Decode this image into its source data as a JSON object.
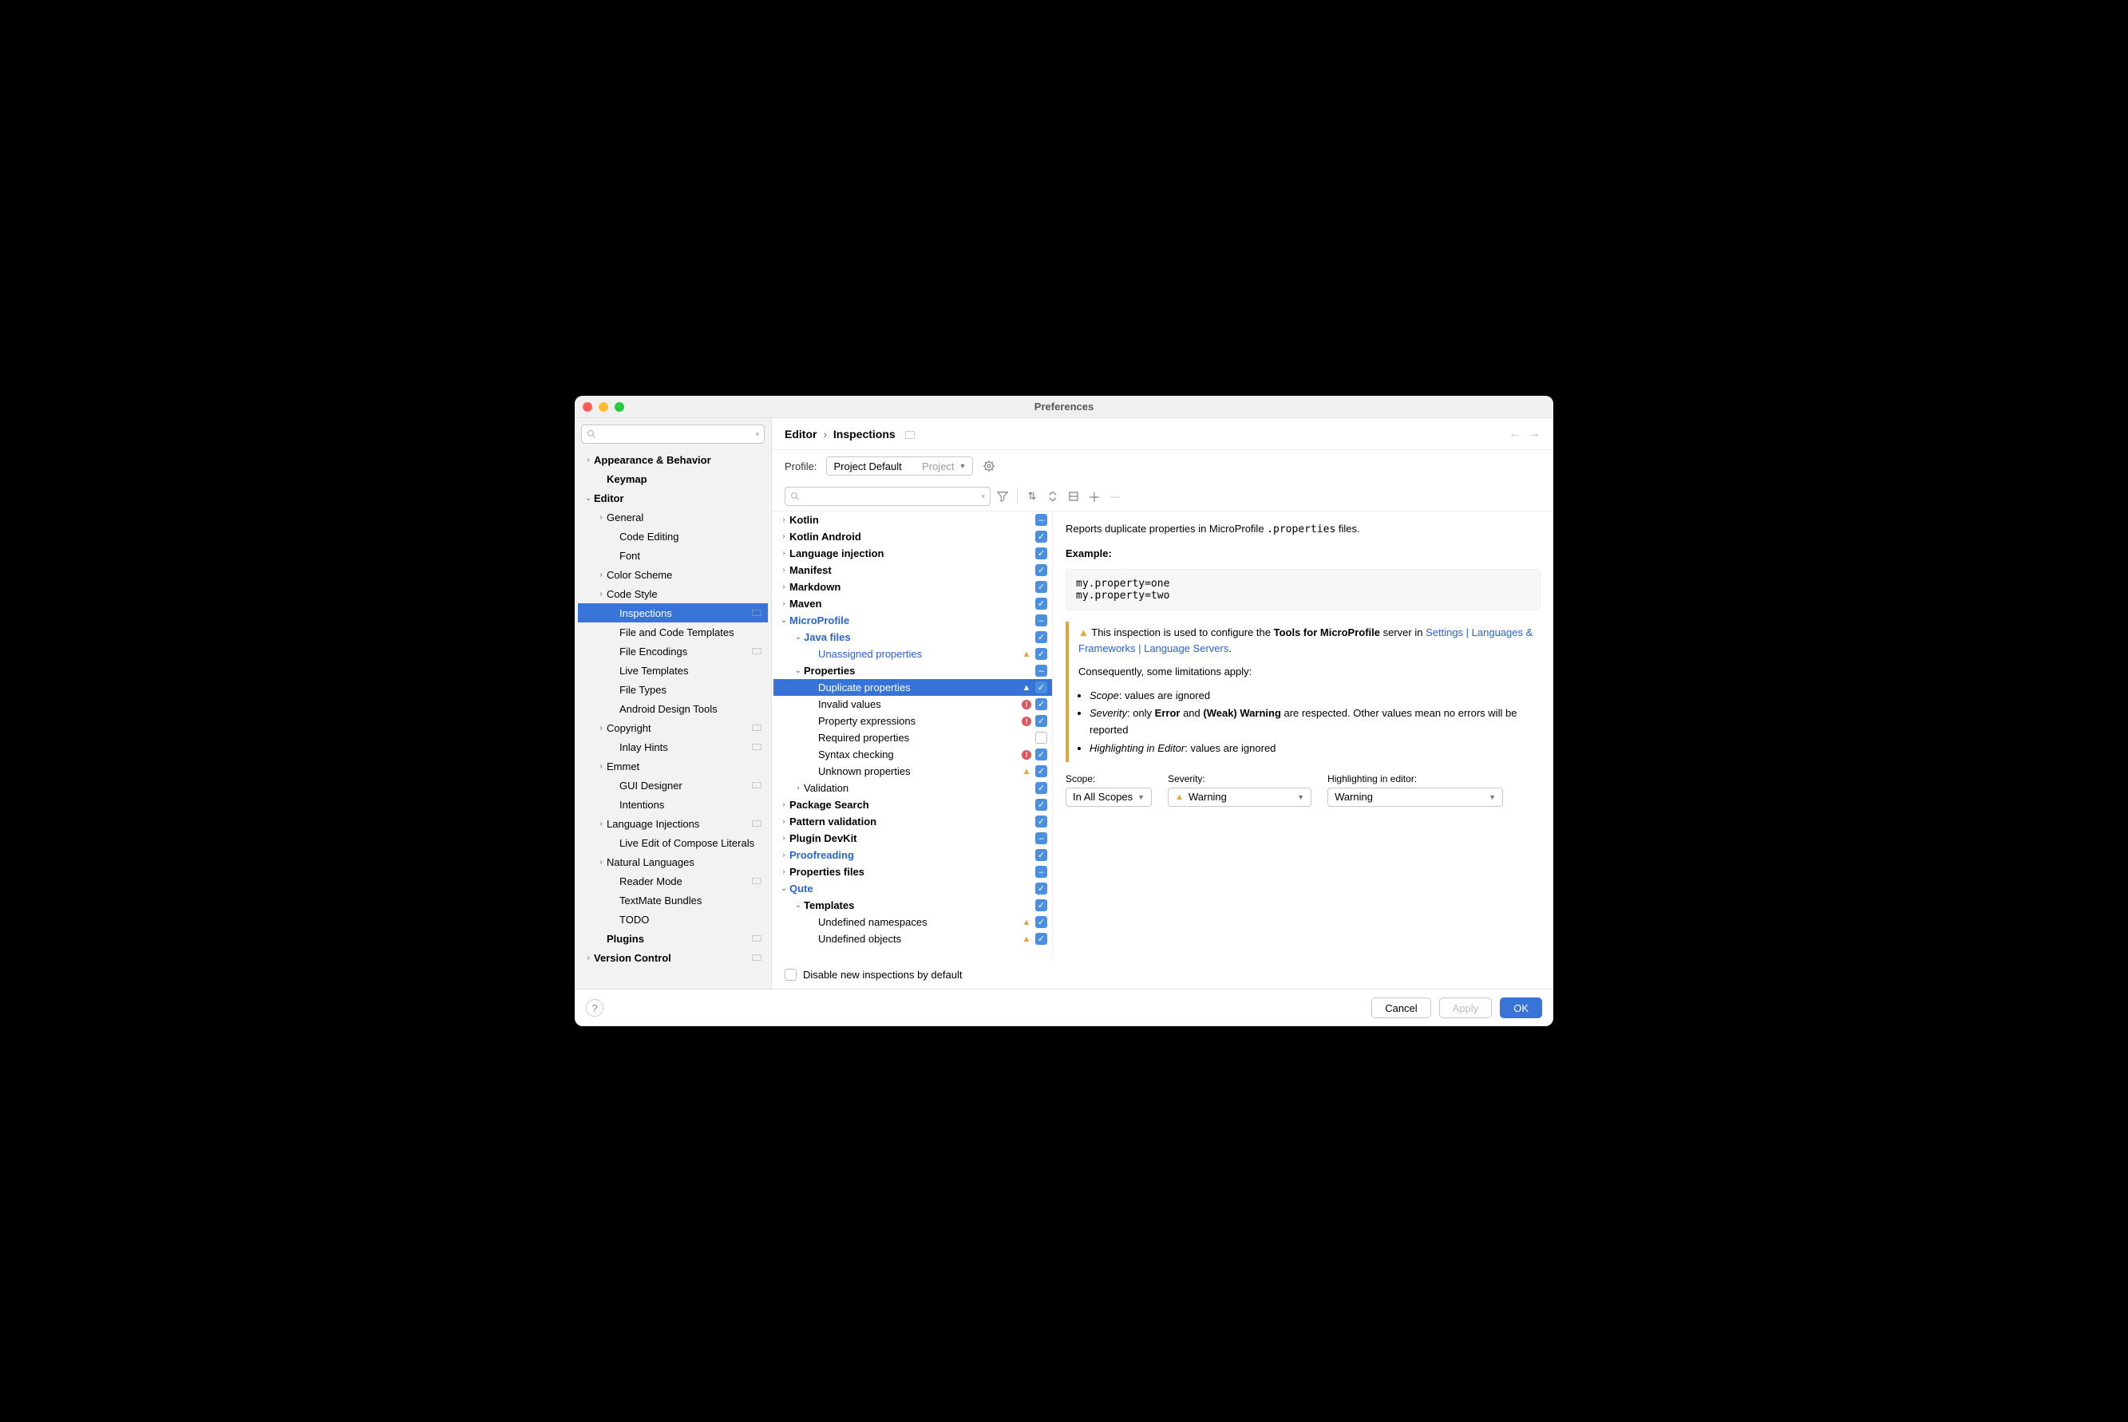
{
  "title": "Preferences",
  "breadcrumbs": [
    "Editor",
    "Inspections"
  ],
  "nav": {
    "back": "←",
    "forward": "→"
  },
  "profile": {
    "label": "Profile:",
    "value": "Project Default",
    "sub": "Project"
  },
  "searchPlaceholder": "",
  "sidebar": [
    {
      "label": "Appearance & Behavior",
      "bold": true,
      "arrow": ">",
      "indent": 0
    },
    {
      "label": "Keymap",
      "bold": true,
      "indent": 1
    },
    {
      "label": "Editor",
      "bold": true,
      "arrow": "v",
      "indent": 0
    },
    {
      "label": "General",
      "indent": 1,
      "arrow": ">"
    },
    {
      "label": "Code Editing",
      "indent": 2
    },
    {
      "label": "Font",
      "indent": 2
    },
    {
      "label": "Color Scheme",
      "indent": 1,
      "arrow": ">"
    },
    {
      "label": "Code Style",
      "indent": 1,
      "arrow": ">"
    },
    {
      "label": "Inspections",
      "indent": 2,
      "selected": true,
      "badge": true
    },
    {
      "label": "File and Code Templates",
      "indent": 2
    },
    {
      "label": "File Encodings",
      "indent": 2,
      "badge": true
    },
    {
      "label": "Live Templates",
      "indent": 2
    },
    {
      "label": "File Types",
      "indent": 2
    },
    {
      "label": "Android Design Tools",
      "indent": 2
    },
    {
      "label": "Copyright",
      "indent": 1,
      "arrow": ">",
      "badge": true
    },
    {
      "label": "Inlay Hints",
      "indent": 2,
      "badge": true
    },
    {
      "label": "Emmet",
      "indent": 1,
      "arrow": ">"
    },
    {
      "label": "GUI Designer",
      "indent": 2,
      "badge": true
    },
    {
      "label": "Intentions",
      "indent": 2
    },
    {
      "label": "Language Injections",
      "indent": 1,
      "arrow": ">",
      "badge": true
    },
    {
      "label": "Live Edit of Compose Literals",
      "indent": 2
    },
    {
      "label": "Natural Languages",
      "indent": 1,
      "arrow": ">"
    },
    {
      "label": "Reader Mode",
      "indent": 2,
      "badge": true
    },
    {
      "label": "TextMate Bundles",
      "indent": 2
    },
    {
      "label": "TODO",
      "indent": 2
    },
    {
      "label": "Plugins",
      "bold": true,
      "indent": 1,
      "badge": true
    },
    {
      "label": "Version Control",
      "bold": true,
      "arrow": ">",
      "indent": 0,
      "badge": true
    }
  ],
  "inspections": [
    {
      "label": "Kotlin",
      "bold": true,
      "arrow": ">",
      "cb": "mixed",
      "indent": 0
    },
    {
      "label": "Kotlin Android",
      "bold": true,
      "arrow": ">",
      "cb": "on",
      "indent": 0
    },
    {
      "label": "Language injection",
      "bold": true,
      "arrow": ">",
      "cb": "on",
      "indent": 0
    },
    {
      "label": "Manifest",
      "bold": true,
      "arrow": ">",
      "cb": "on",
      "indent": 0
    },
    {
      "label": "Markdown",
      "bold": true,
      "arrow": ">",
      "cb": "on",
      "indent": 0
    },
    {
      "label": "Maven",
      "bold": true,
      "arrow": ">",
      "cb": "on",
      "indent": 0
    },
    {
      "label": "MicroProfile",
      "bold": true,
      "arrow": "v",
      "cb": "mixed",
      "indent": 0,
      "mod": true
    },
    {
      "label": "Java files",
      "bold": true,
      "arrow": "v",
      "cb": "on",
      "indent": 1,
      "mod": true
    },
    {
      "label": "Unassigned properties",
      "cb": "on",
      "indent": 2,
      "mod": true,
      "ic": "warn"
    },
    {
      "label": "Properties",
      "bold": true,
      "arrow": "v",
      "cb": "mixed",
      "indent": 1
    },
    {
      "label": "Duplicate properties",
      "cb": "on",
      "indent": 2,
      "mod": true,
      "ic": "warn",
      "selected": true
    },
    {
      "label": "Invalid values",
      "cb": "on",
      "indent": 2,
      "ic": "err"
    },
    {
      "label": "Property expressions",
      "cb": "on",
      "indent": 2,
      "ic": "err"
    },
    {
      "label": "Required properties",
      "cb": "off",
      "indent": 2
    },
    {
      "label": "Syntax checking",
      "cb": "on",
      "indent": 2,
      "ic": "err"
    },
    {
      "label": "Unknown properties",
      "cb": "on",
      "indent": 2,
      "ic": "warn"
    },
    {
      "label": "Validation",
      "arrow": ">",
      "cb": "on",
      "indent": 1
    },
    {
      "label": "Package Search",
      "bold": true,
      "arrow": ">",
      "cb": "on",
      "indent": 0
    },
    {
      "label": "Pattern validation",
      "bold": true,
      "arrow": ">",
      "cb": "on",
      "indent": 0
    },
    {
      "label": "Plugin DevKit",
      "bold": true,
      "arrow": ">",
      "cb": "mixed",
      "indent": 0
    },
    {
      "label": "Proofreading",
      "bold": true,
      "arrow": ">",
      "cb": "on",
      "indent": 0,
      "mod": true
    },
    {
      "label": "Properties files",
      "bold": true,
      "arrow": ">",
      "cb": "mixed",
      "indent": 0
    },
    {
      "label": "Qute",
      "bold": true,
      "arrow": "v",
      "cb": "on",
      "indent": 0,
      "mod": true
    },
    {
      "label": "Templates",
      "bold": true,
      "arrow": "v",
      "cb": "on",
      "indent": 1
    },
    {
      "label": "Undefined namespaces",
      "cb": "on",
      "indent": 2,
      "ic": "warn"
    },
    {
      "label": "Undefined objects",
      "cb": "on",
      "indent": 2,
      "ic": "warn"
    }
  ],
  "disableLabel": "Disable new inspections by default",
  "detail": {
    "intro1": "Reports duplicate properties in MicroProfile ",
    "introCode": ".properties",
    "intro2": " files.",
    "exampleLabel": "Example:",
    "code": "my.property=one\nmy.property=two",
    "note": {
      "pre": "This inspection is used to configure the ",
      "bold1": "Tools for MicroProfile",
      "mid1": " server in ",
      "link": "Settings | Languages & Frameworks | Language Servers",
      "mid2": ".",
      "para2": "Consequently, some limitations apply:",
      "b1a": "Scope",
      "b1b": ": values are ignored",
      "b2a": "Severity",
      "b2b": ": only ",
      "b2c": "Error",
      "b2d": " and ",
      "b2e": "(Weak) Warning",
      "b2f": " are respected. Other values mean no errors will be reported",
      "b3a": "Highlighting in Editor",
      "b3b": ": values are ignored"
    },
    "scope": {
      "label": "Scope:",
      "value": "In All Scopes"
    },
    "severity": {
      "label": "Severity:",
      "value": "Warning"
    },
    "highlight": {
      "label": "Highlighting in editor:",
      "value": "Warning"
    }
  },
  "buttons": {
    "cancel": "Cancel",
    "apply": "Apply",
    "ok": "OK"
  }
}
